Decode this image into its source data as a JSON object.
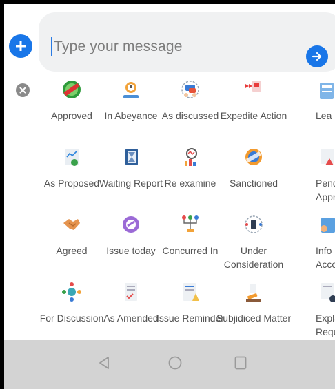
{
  "composer": {
    "placeholder": "Type your message",
    "add_icon": "plus-circle-icon",
    "send_icon": "arrow-right-icon",
    "close_icon": "close-circle-icon"
  },
  "stickers": [
    {
      "label": "Approved",
      "icon": "approved-stamp-icon"
    },
    {
      "label": "In Abeyance",
      "icon": "hourglass-hand-icon"
    },
    {
      "label": "As discussed",
      "icon": "chat-people-icon"
    },
    {
      "label": "Expedite Action",
      "icon": "fast-forward-document-icon"
    },
    {
      "label": "Lea",
      "icon": "leave-document-icon"
    },
    {
      "label": "As Proposed",
      "icon": "proposal-chart-icon"
    },
    {
      "label": "Waiting Report",
      "icon": "clipboard-hourglass-icon"
    },
    {
      "label": "Re examine",
      "icon": "magnifier-chart-icon"
    },
    {
      "label": "Sanctioned",
      "icon": "sanctioned-seal-icon"
    },
    {
      "label": "Pend Appro",
      "icon": "pending-warning-icon"
    },
    {
      "label": "Agreed",
      "icon": "handshake-icon"
    },
    {
      "label": "Issue today",
      "icon": "issue-arrows-icon"
    },
    {
      "label": "Concurred In",
      "icon": "concurrence-tree-icon"
    },
    {
      "label": "Under Consideration",
      "icon": "consideration-circle-icon"
    },
    {
      "label": "Info Accord",
      "icon": "info-person-icon"
    },
    {
      "label": "For Discussion",
      "icon": "discussion-group-icon"
    },
    {
      "label": "As Amended",
      "icon": "amended-document-icon"
    },
    {
      "label": "Issue Reminder",
      "icon": "reminder-document-icon"
    },
    {
      "label": "Subjidiced Matter",
      "icon": "gavel-icon"
    },
    {
      "label": "Explan Requ",
      "icon": "explanation-document-icon"
    }
  ],
  "navbar": {
    "back_icon": "nav-back-icon",
    "home_icon": "nav-home-icon",
    "recents_icon": "nav-recents-icon"
  }
}
